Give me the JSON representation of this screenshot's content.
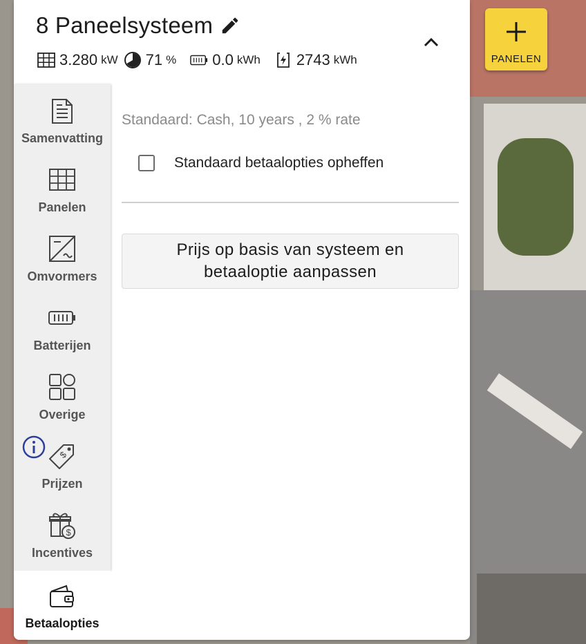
{
  "header": {
    "title": "8 Paneelsysteem",
    "stats": {
      "power_value": "3.280",
      "power_unit": "kW",
      "offset_value": "71",
      "offset_unit": "%",
      "battery_value": "0.0",
      "battery_unit": "kWh",
      "production_value": "2743",
      "production_unit": "kWh"
    }
  },
  "sidebar": {
    "items": [
      {
        "label": "Samenvatting",
        "icon": "document-icon"
      },
      {
        "label": "Panelen",
        "icon": "panel-grid-icon"
      },
      {
        "label": "Omvormers",
        "icon": "inverter-icon"
      },
      {
        "label": "Batterijen",
        "icon": "battery-icon"
      },
      {
        "label": "Overige",
        "icon": "grid-shapes-icon"
      },
      {
        "label": "Prijzen",
        "icon": "price-tag-icon"
      },
      {
        "label": "Incentives",
        "icon": "gift-money-icon"
      },
      {
        "label": "Betaalopties",
        "icon": "wallet-icon"
      }
    ]
  },
  "content": {
    "standard_text": "Standaard: Cash, 10 years , 2 % rate",
    "override_label": "Standaard betaalopties opheffen",
    "override_checked": false,
    "price_button": "Prijs op basis van systeem en betaaloptie aanpassen"
  },
  "add_button": {
    "label": "PANELEN"
  },
  "colors": {
    "accent_yellow": "#f6d33d",
    "info_blue": "#2d3f9a",
    "sidebar_bg": "#efefef"
  }
}
